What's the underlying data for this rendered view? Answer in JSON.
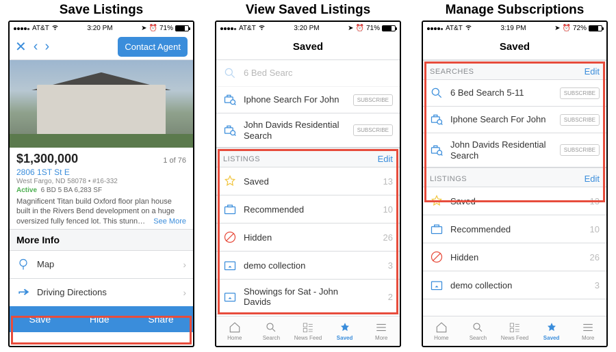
{
  "titles": {
    "col1": "Save Listings",
    "col2": "View Saved Listings",
    "col3": "Manage Subscriptions"
  },
  "status": {
    "carrier": "AT&T",
    "time1": "3:20 PM",
    "time2": "3:20 PM",
    "time3": "3:19 PM",
    "batt1": "71%",
    "batt2": "71%",
    "batt3": "72%"
  },
  "phone1": {
    "contact_btn": "Contact Agent",
    "price": "$1,300,000",
    "count": "1 of 76",
    "address": "2806 1ST St E",
    "subaddress": "West Fargo, ND 58078 • #16-332",
    "status": "Active",
    "specs": "6 BD   5 BA   6,283 SF",
    "desc": "Magnificent Titan build Oxford floor plan house built in the Rivers Bend development on a huge oversized fully fenced lot. This stunn…",
    "seemore": "See More",
    "more_info": "More Info",
    "map": "Map",
    "driving": "Driving Directions",
    "save": "Save",
    "hide": "Hide",
    "share": "Share"
  },
  "phone2": {
    "header": "Saved",
    "ghost_search": "6 Bed Searc",
    "search1": "Iphone Search For John",
    "search2": "John Davids Residential Search",
    "subscribe": "SUBSCRIBE",
    "listings_label": "LISTINGS",
    "edit": "Edit",
    "items": [
      {
        "label": "Saved",
        "count": "13"
      },
      {
        "label": "Recommended",
        "count": "10"
      },
      {
        "label": "Hidden",
        "count": "26"
      },
      {
        "label": "demo collection",
        "count": "3"
      },
      {
        "label": "Showings for Sat - John Davids",
        "count": "2"
      }
    ]
  },
  "phone3": {
    "header": "Saved",
    "searches_label": "SEARCHES",
    "edit": "Edit",
    "subscribe": "SUBSCRIBE",
    "searches": [
      "6 Bed Search 5-11",
      "Iphone Search For John",
      "John Davids Residential Search"
    ],
    "listings_label": "LISTINGS",
    "items": [
      {
        "label": "Saved",
        "count": "13"
      },
      {
        "label": "Recommended",
        "count": "10"
      },
      {
        "label": "Hidden",
        "count": "26"
      },
      {
        "label": "demo collection",
        "count": "3"
      }
    ]
  },
  "tabs": {
    "home": "Home",
    "search": "Search",
    "news": "News Feed",
    "saved": "Saved",
    "more": "More"
  }
}
